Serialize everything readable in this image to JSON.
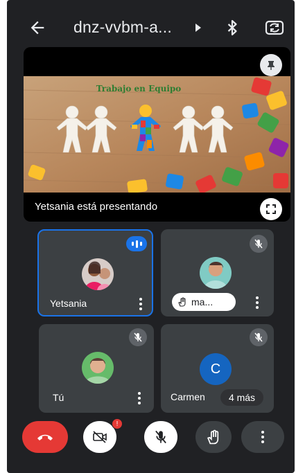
{
  "header": {
    "meeting_code": "dnz-vvbm-a...",
    "icons": [
      "back-arrow-icon",
      "caret-right-icon",
      "bluetooth-icon",
      "switch-camera-icon"
    ]
  },
  "presentation": {
    "slide_title": "Trabajo en Equipo",
    "caption": "Yetsania está presentando",
    "icons": [
      "pin-icon",
      "fullscreen-icon"
    ]
  },
  "participants": [
    {
      "name": "Yetsania",
      "state": "speaking",
      "avatar": "photo"
    },
    {
      "name": "ma...",
      "state": "muted",
      "chip_icon": "raised-hand-icon",
      "avatar": "photo"
    },
    {
      "name": "Tú",
      "state": "muted",
      "avatar": "photo"
    },
    {
      "name": "Carmen",
      "state": "muted",
      "avatar_letter": "C",
      "more_label": "4 más"
    }
  ],
  "controls": {
    "camera_badge": "!",
    "buttons": [
      "end-call",
      "camera-off",
      "mic-off",
      "raise-hand",
      "more-options"
    ]
  },
  "colors": {
    "background": "#202124",
    "tile": "#3c4043",
    "accent": "#1a73e8",
    "end_call": "#e53935"
  }
}
